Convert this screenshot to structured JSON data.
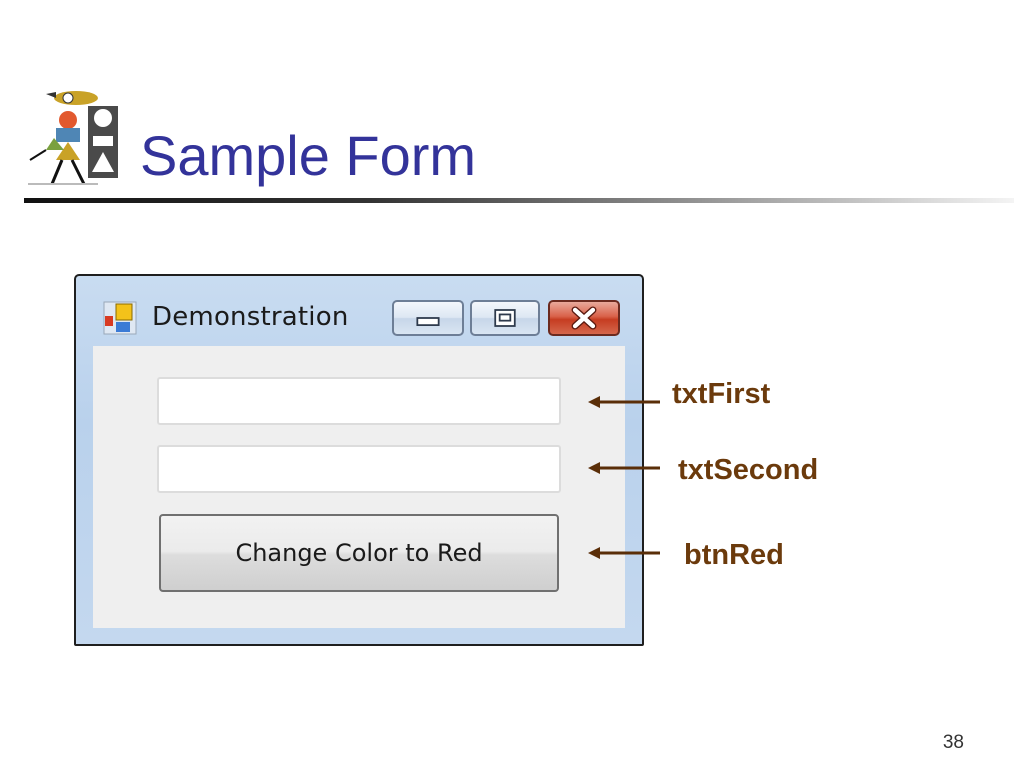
{
  "slide": {
    "title": "Sample Form",
    "page_number": "38"
  },
  "window": {
    "title": "Demonstration",
    "first_textbox_value": "",
    "second_textbox_value": "",
    "button_label": "Change Color to Red"
  },
  "callouts": {
    "first": "txtFirst",
    "second": "txtSecond",
    "button": "btnRed"
  },
  "colors": {
    "title": "#33339a",
    "callout": "#6b3a0c",
    "arrow": "#5a2e08",
    "close_button": "#c63d22"
  },
  "icons": {
    "slide_logo": "people-shapes-icon",
    "app": "form-app-icon",
    "minimize": "minimize-icon",
    "maximize": "maximize-icon",
    "close": "close-icon"
  }
}
